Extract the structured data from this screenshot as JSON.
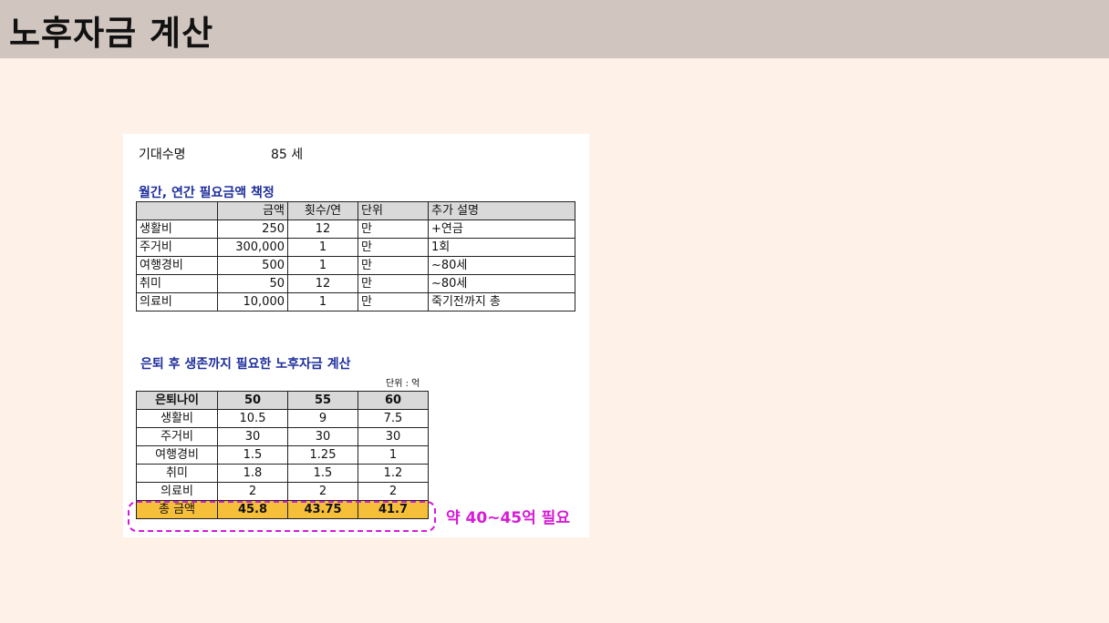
{
  "page": {
    "title": "노후자금 계산"
  },
  "life_expectancy": {
    "label": "기대수명",
    "value": "85 세"
  },
  "monthly_section": {
    "title": "월간, 연간 필요금액 책정",
    "headers": [
      "",
      "금액",
      "횟수/연",
      "단위",
      "추가 설명"
    ],
    "rows": [
      [
        "생활비",
        "250",
        "12",
        "만",
        "+연금"
      ],
      [
        "주거비",
        "300,000",
        "1",
        "만",
        "1회"
      ],
      [
        "여행경비",
        "500",
        "1",
        "만",
        "~80세"
      ],
      [
        "취미",
        "50",
        "12",
        "만",
        "~80세"
      ],
      [
        "의료비",
        "10,000",
        "1",
        "만",
        "죽기전까지 총"
      ]
    ]
  },
  "retirement_section": {
    "title": "은퇴 후 생존까지 필요한 노후자금 계산",
    "unit_note": "단위 : 억",
    "headers": [
      "은퇴나이",
      "50",
      "55",
      "60"
    ],
    "rows": [
      [
        "생활비",
        "10.5",
        "9",
        "7.5"
      ],
      [
        "주거비",
        "30",
        "30",
        "30"
      ],
      [
        "여행경비",
        "1.5",
        "1.25",
        "1"
      ],
      [
        "취미",
        "1.8",
        "1.5",
        "1.2"
      ],
      [
        "의료비",
        "2",
        "2",
        "2"
      ]
    ],
    "total": [
      "총 금액",
      "45.8",
      "43.75",
      "41.7"
    ]
  },
  "callout": {
    "text": "약 40~45억 필요",
    "color": "#d61ad6"
  },
  "colors": {
    "title_bar": "#d0c6bf",
    "background": "#fdf1e8",
    "total_row": "#f6bf3a",
    "section_title": "#1f2f9c"
  }
}
